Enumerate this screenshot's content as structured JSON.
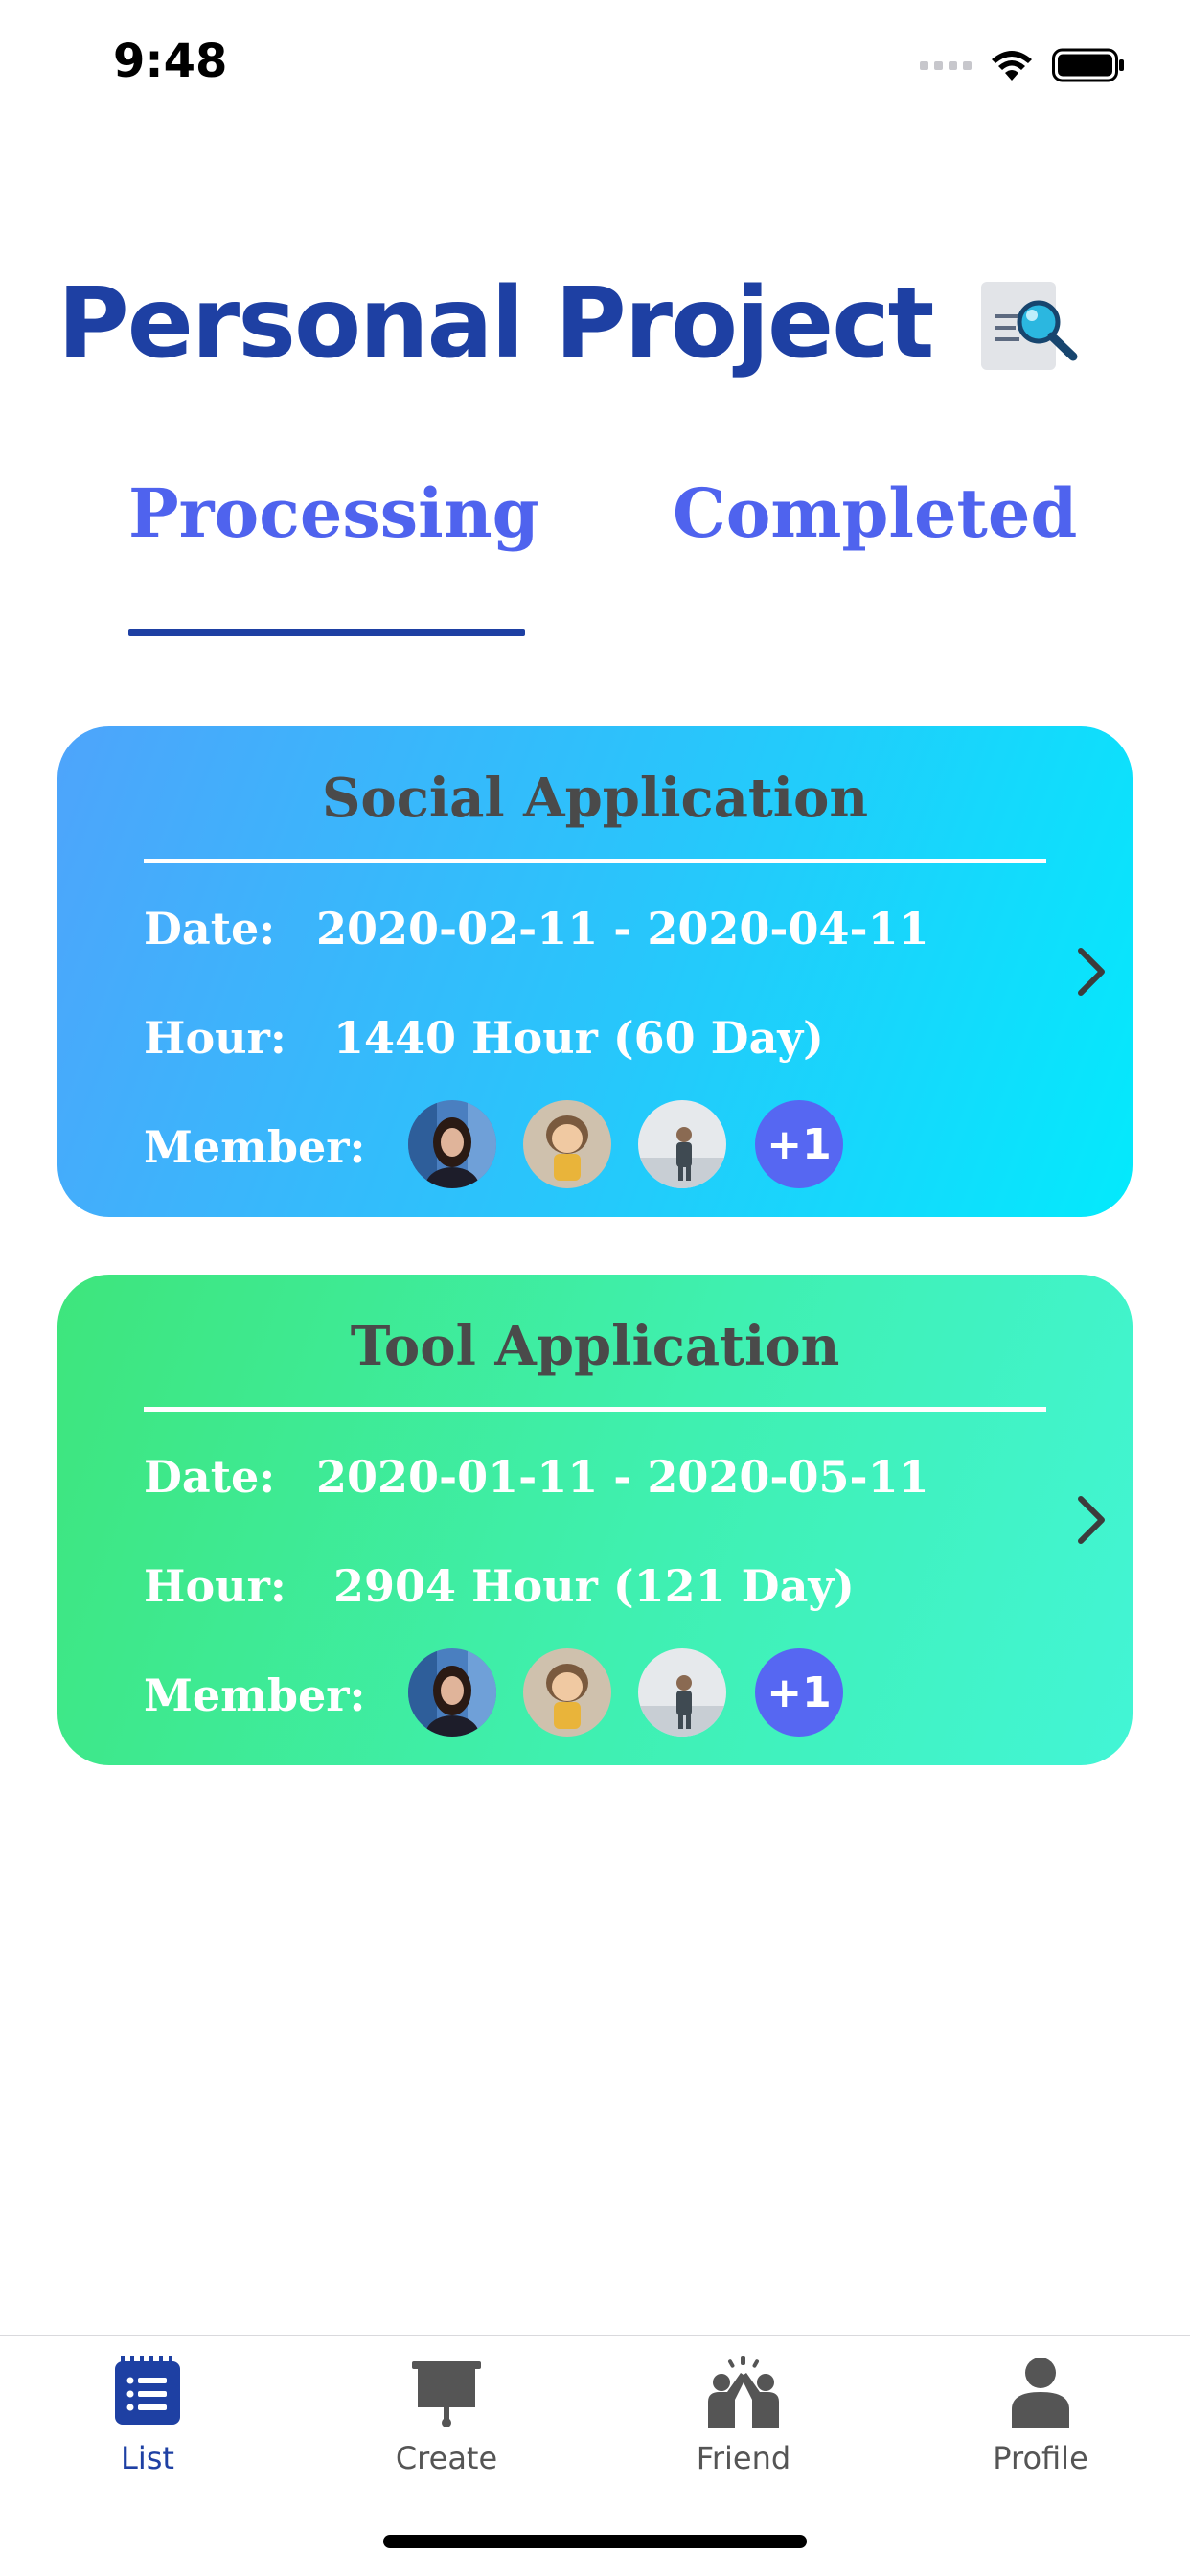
{
  "status_bar": {
    "time": "9:48",
    "icons": [
      "signal-dots",
      "wifi-icon",
      "battery-icon"
    ]
  },
  "header": {
    "title": "Personal Project",
    "search_icon": "search-list-icon"
  },
  "tabs": [
    {
      "label": "Processing",
      "active": true
    },
    {
      "label": "Completed",
      "active": false
    }
  ],
  "projects": [
    {
      "title": "Social Application",
      "date_label": "Date:",
      "date_value": "2020-02-11 - 2020-04-11",
      "hour_label": "Hour:",
      "hour_value": "1440 Hour (60 Day)",
      "member_label": "Member:",
      "extra_members": "+1",
      "gradient": [
        "#4ea4fb",
        "#03eafc"
      ]
    },
    {
      "title": "Tool Application",
      "date_label": "Date:",
      "date_value": "2020-01-11 - 2020-05-11",
      "hour_label": "Hour:",
      "hour_value": "2904 Hour (121 Day)",
      "member_label": "Member:",
      "extra_members": "+1",
      "gradient": [
        "#3ee57c",
        "#42f5d6"
      ]
    }
  ],
  "tabbar": {
    "items": [
      {
        "label": "List",
        "icon": "list-icon",
        "active": true
      },
      {
        "label": "Create",
        "icon": "presentation-board-icon",
        "active": false
      },
      {
        "label": "Friend",
        "icon": "high-five-icon",
        "active": false
      },
      {
        "label": "Profile",
        "icon": "person-icon",
        "active": false
      }
    ]
  },
  "colors": {
    "accent": "#1e40a3",
    "tab_text": "#4f63ee",
    "badge": "#5667f2"
  }
}
